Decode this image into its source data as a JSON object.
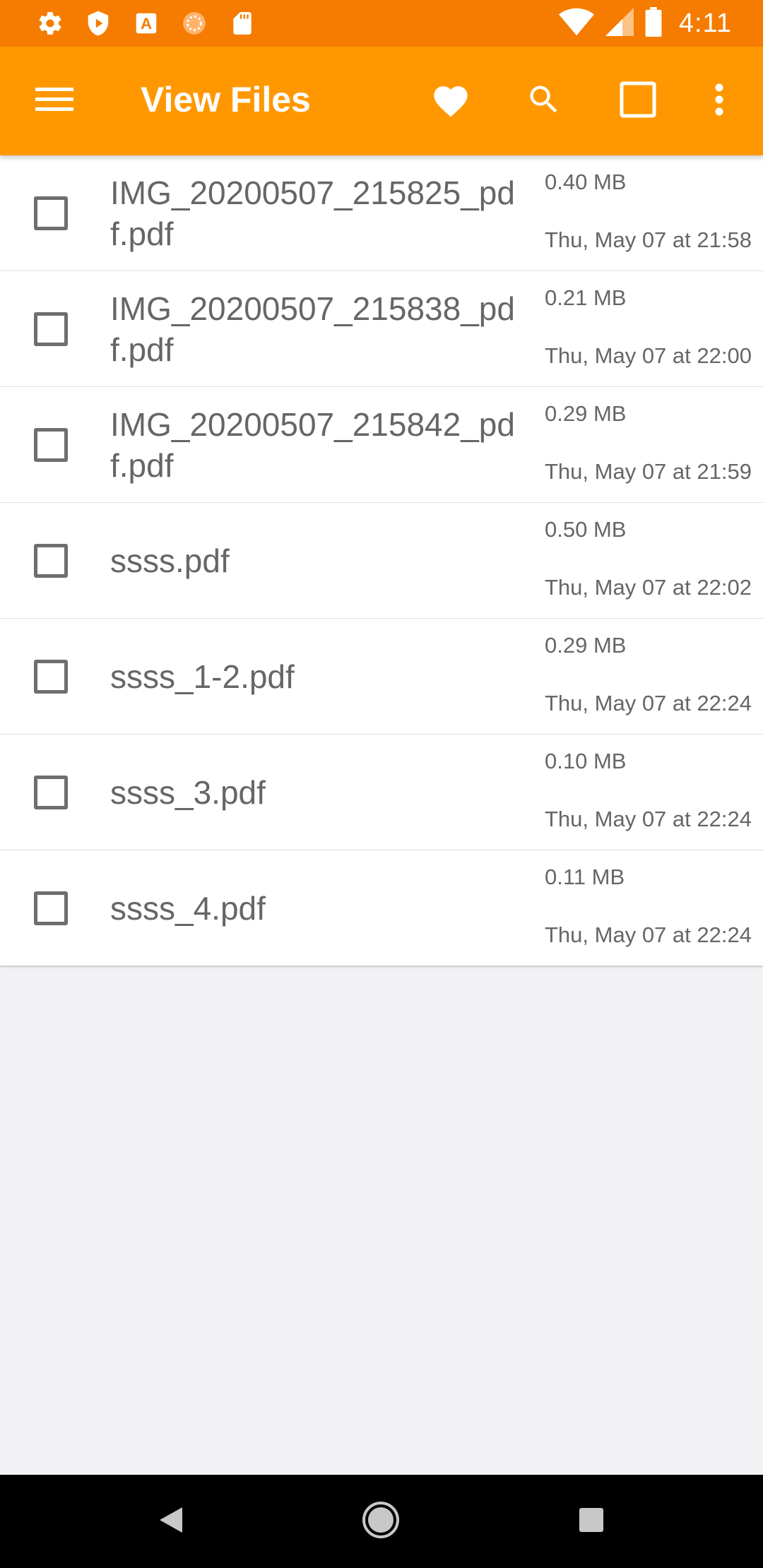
{
  "status_bar": {
    "time": "4:11",
    "left_icons": [
      "settings-icon",
      "play-protect-icon",
      "font-a-icon",
      "sync-circle-icon",
      "sd-card-icon"
    ],
    "right_icons": [
      "wifi-icon",
      "cellular-signal-icon",
      "battery-icon"
    ]
  },
  "app_bar": {
    "title": "View Files",
    "icons": [
      "menu-icon",
      "favorite-heart-icon",
      "search-icon",
      "select-all-square-icon",
      "more-vert-icon"
    ]
  },
  "files": [
    {
      "name": "IMG_20200507_215825_pdf.pdf",
      "size": "0.40 MB",
      "date": "Thu, May 07 at 21:58"
    },
    {
      "name": "IMG_20200507_215838_pdf.pdf",
      "size": "0.21 MB",
      "date": "Thu, May 07 at 22:00"
    },
    {
      "name": "IMG_20200507_215842_pdf.pdf",
      "size": "0.29 MB",
      "date": "Thu, May 07 at 21:59"
    },
    {
      "name": "ssss.pdf",
      "size": "0.50 MB",
      "date": "Thu, May 07 at 22:02"
    },
    {
      "name": "ssss_1-2.pdf",
      "size": "0.29 MB",
      "date": "Thu, May 07 at 22:24"
    },
    {
      "name": "ssss_3.pdf",
      "size": "0.10 MB",
      "date": "Thu, May 07 at 22:24"
    },
    {
      "name": "ssss_4.pdf",
      "size": "0.11 MB",
      "date": "Thu, May 07 at 22:24"
    }
  ],
  "nav_bar": {
    "icons": [
      "back-icon",
      "home-icon",
      "recents-icon"
    ]
  },
  "colors": {
    "status_bar": "#f57c00",
    "app_bar": "#ff9800",
    "background": "#f2f2f4",
    "text": "#666666"
  }
}
